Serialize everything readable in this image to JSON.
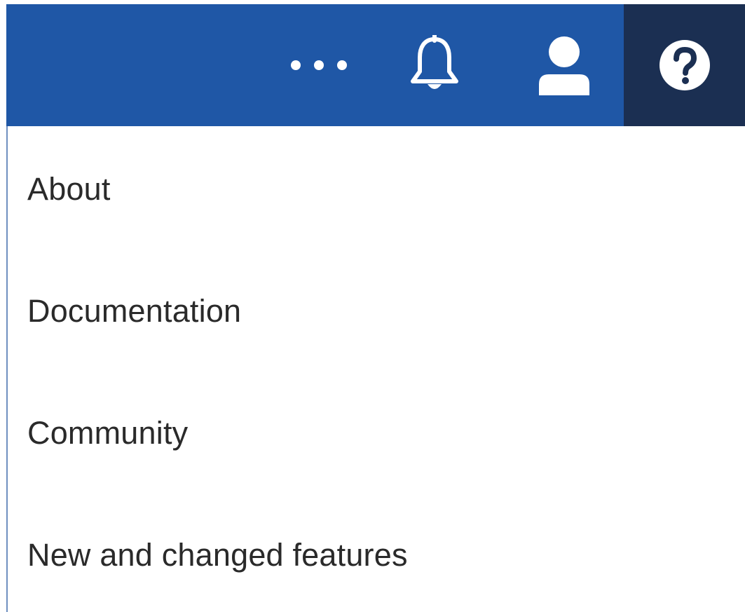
{
  "header": {
    "actions": [
      {
        "name": "more",
        "icon": "ellipsis-icon"
      },
      {
        "name": "notifications",
        "icon": "bell-icon"
      },
      {
        "name": "user",
        "icon": "user-icon"
      },
      {
        "name": "help",
        "icon": "help-icon",
        "active": true
      }
    ],
    "colors": {
      "bar": "#1f57a6",
      "active_button": "#1b2f52",
      "icon": "#ffffff"
    }
  },
  "help_menu": {
    "items": [
      {
        "label": "About"
      },
      {
        "label": "Documentation"
      },
      {
        "label": "Community"
      },
      {
        "label": "New and changed features"
      }
    ]
  }
}
